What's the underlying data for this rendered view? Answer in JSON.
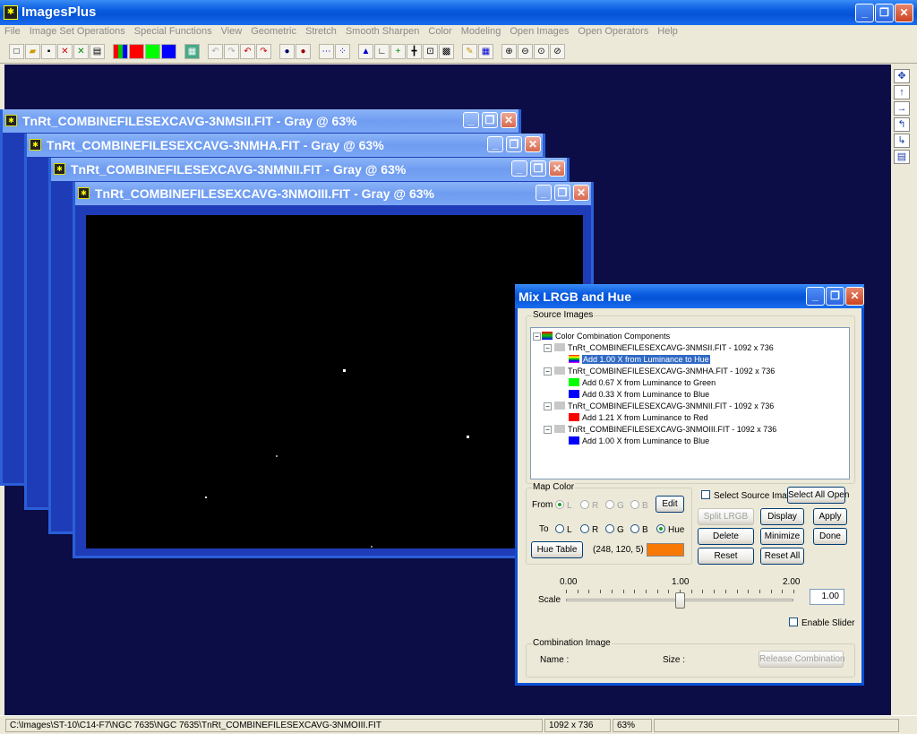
{
  "app": {
    "title": "ImagesPlus"
  },
  "menu": [
    "File",
    "Image Set Operations",
    "Special Functions",
    "View",
    "Geometric",
    "Stretch",
    "Smooth Sharpen",
    "Color",
    "Modeling",
    "Open Images",
    "Open Operators",
    "Help"
  ],
  "image_windows": [
    {
      "title": "TnRt_COMBINEFILESEXCAVG-3NMSII.FIT - Gray @ 63%"
    },
    {
      "title": "TnRt_COMBINEFILESEXCAVG-3NMHA.FIT - Gray @ 63%"
    },
    {
      "title": "TnRt_COMBINEFILESEXCAVG-3NMNII.FIT - Gray @ 63%"
    },
    {
      "title": "TnRt_COMBINEFILESEXCAVG-3NMOIII.FIT - Gray @ 63%"
    }
  ],
  "dialog": {
    "title": "Mix LRGB and Hue",
    "source_label": "Source Images",
    "tree": {
      "root": "Color Combination Components",
      "images": [
        {
          "name": "TnRt_COMBINEFILESEXCAVG-3NMSII.FIT - 1092 x 736",
          "items": [
            {
              "text": "Add 1.00 X from Luminance to Hue",
              "color": "rainbow",
              "selected": true
            }
          ]
        },
        {
          "name": "TnRt_COMBINEFILESEXCAVG-3NMHA.FIT - 1092 x 736",
          "items": [
            {
              "text": "Add 0.67 X from Luminance to Green",
              "color": "#00ff00"
            },
            {
              "text": "Add 0.33 X from Luminance to Blue",
              "color": "#0000ff"
            }
          ]
        },
        {
          "name": "TnRt_COMBINEFILESEXCAVG-3NMNII.FIT - 1092 x 736",
          "items": [
            {
              "text": "Add 1.21 X from Luminance to Red",
              "color": "#ff0000"
            }
          ]
        },
        {
          "name": "TnRt_COMBINEFILESEXCAVG-3NMOIII.FIT - 1092 x 736",
          "items": [
            {
              "text": "Add 1.00 X from Luminance to Blue",
              "color": "#0000ff"
            }
          ]
        }
      ]
    },
    "map_color": {
      "label": "Map Color",
      "from_label": "From",
      "to_label": "To",
      "from_options": [
        "L",
        "R",
        "G",
        "B"
      ],
      "to_options": [
        "L",
        "R",
        "G",
        "B",
        "Hue"
      ],
      "selected_from": "L",
      "selected_to": "Hue",
      "edit": "Edit",
      "hue_table": "Hue Table",
      "hue_value": "(248, 120, 5)",
      "hue_swatch": "#f87805"
    },
    "select_source": "Select Source Image",
    "buttons": {
      "select_all_open": "Select All Open",
      "split_lrgb": "Split LRGB",
      "display": "Display",
      "apply": "Apply",
      "delete": "Delete",
      "minimize": "Minimize",
      "done": "Done",
      "reset": "Reset",
      "reset_all": "Reset All"
    },
    "scale": {
      "label": "Scale",
      "min": "0.00",
      "mid": "1.00",
      "max": "2.00",
      "value": "1.00",
      "fraction": 0.5
    },
    "enable_slider": "Enable Slider",
    "combination": {
      "label": "Combination Image",
      "name_label": "Name :",
      "size_label": "Size :",
      "release": "Release Combination"
    }
  },
  "status": {
    "path": "C:\\Images\\ST-10\\C14-F7\\NGC 7635\\NGC 7635\\TnRt_COMBINEFILESEXCAVG-3NMOIII.FIT",
    "size": "1092 x 736",
    "zoom": "63%"
  },
  "colors": {
    "workspace": "#0c0c46",
    "titlebar": "#0653d6"
  }
}
